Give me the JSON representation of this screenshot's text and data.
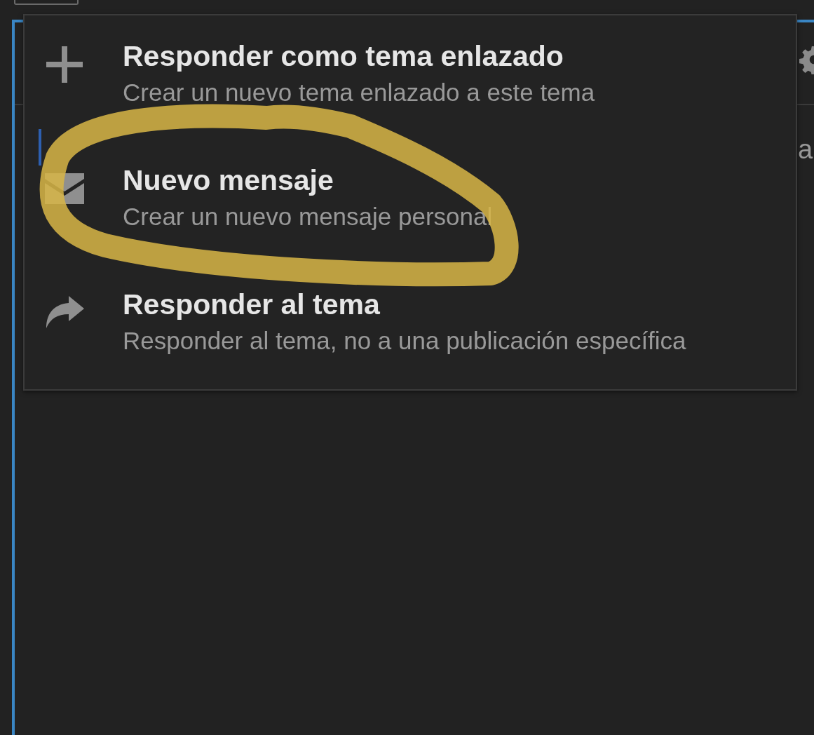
{
  "menu": {
    "items": [
      {
        "kind": "plus",
        "title": "Responder como tema enlazado",
        "description": "Crear un nuevo tema enlazado a este tema"
      },
      {
        "kind": "envelope",
        "title": "Nuevo mensaje",
        "description": "Crear un nuevo mensaje personal"
      },
      {
        "kind": "reply",
        "title": "Responder al tema",
        "description": "Responder al tema, no a una publicación específica"
      }
    ]
  },
  "panel": {
    "text_fragment": "a"
  },
  "annotation": {
    "kind": "highlight_loop"
  }
}
